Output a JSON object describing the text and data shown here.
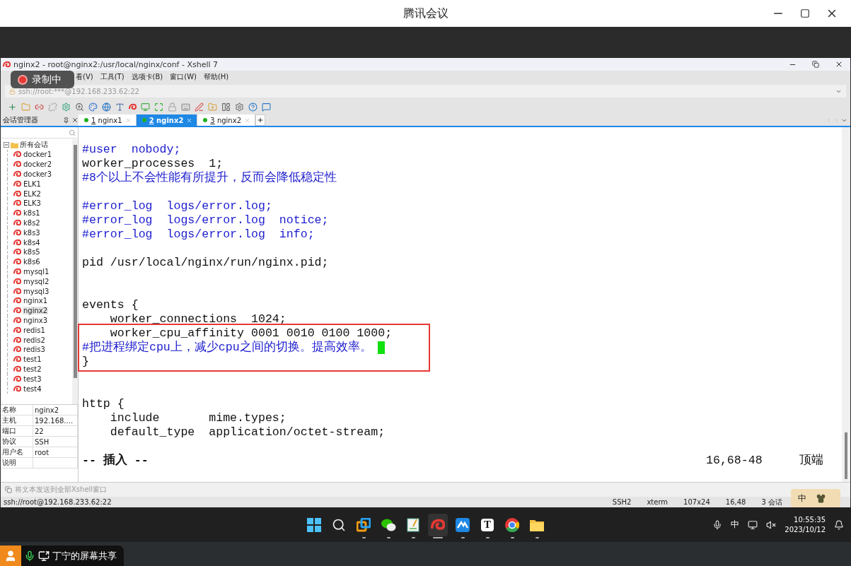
{
  "meeting_window": {
    "title": "腾讯会议"
  },
  "recording_badge": {
    "label": "录制中"
  },
  "xshell": {
    "title": "nginx2 - root@nginx2:/usr/local/nginx/conf - Xshell 7",
    "menu": [
      "看(V)",
      "工具(T)",
      "选项卡(B)",
      "窗口(W)",
      "帮助(H)"
    ],
    "address": "ssh://root:***@192.168.233.62:22",
    "session_panel": {
      "title": "会话管理器",
      "root": {
        "label": "所有会话",
        "expanded": true,
        "children": [
          {
            "label": "docker1",
            "selected": false
          },
          {
            "label": "docker2",
            "selected": false
          },
          {
            "label": "docker3",
            "selected": false
          },
          {
            "label": "ELK1",
            "selected": false
          },
          {
            "label": "ELK2",
            "selected": false
          },
          {
            "label": "ELK3",
            "selected": false
          },
          {
            "label": "k8s1",
            "selected": false
          },
          {
            "label": "k8s2",
            "selected": false
          },
          {
            "label": "k8s3",
            "selected": false
          },
          {
            "label": "k8s4",
            "selected": false
          },
          {
            "label": "k8s5",
            "selected": false
          },
          {
            "label": "k8s6",
            "selected": false
          },
          {
            "label": "mysql1",
            "selected": false
          },
          {
            "label": "mysql2",
            "selected": false
          },
          {
            "label": "mysql3",
            "selected": false
          },
          {
            "label": "nginx1",
            "selected": false
          },
          {
            "label": "nginx2",
            "selected": true
          },
          {
            "label": "nginx3",
            "selected": false
          },
          {
            "label": "redis1",
            "selected": false
          },
          {
            "label": "redis2",
            "selected": false
          },
          {
            "label": "redis3",
            "selected": false
          },
          {
            "label": "test1",
            "selected": false
          },
          {
            "label": "test2",
            "selected": false
          },
          {
            "label": "test3",
            "selected": false
          },
          {
            "label": "test4",
            "selected": false
          }
        ]
      }
    },
    "tabs": [
      {
        "number": "1",
        "label": "nginx1",
        "selected": false
      },
      {
        "number": "2",
        "label": "nginx2",
        "selected": true
      },
      {
        "number": "3",
        "label": "nginx2",
        "selected": false
      }
    ],
    "properties": [
      {
        "name": "名称",
        "value": "nginx2"
      },
      {
        "name": "主机",
        "value": "192.168...."
      },
      {
        "name": "端口",
        "value": "22"
      },
      {
        "name": "协议",
        "value": "SSH"
      },
      {
        "name": "用户名",
        "value": "root"
      },
      {
        "name": "说明"
      }
    ],
    "terminal": {
      "sections": [
        {
          "highlighted": false,
          "lines": [
            {
              "kind": "comment",
              "text": "#user  nobody;",
              "cursor": false
            },
            {
              "kind": "code",
              "text": "worker_processes  1;",
              "cursor": false
            },
            {
              "kind": "comment",
              "text": "#8个以上不会性能有所提升，反而会降低稳定性",
              "cursor": false
            },
            {
              "kind": "blank"
            },
            {
              "kind": "comment",
              "text": "#error_log  logs/error.log;",
              "cursor": false
            },
            {
              "kind": "comment",
              "text": "#error_log  logs/error.log  notice;",
              "cursor": false
            },
            {
              "kind": "comment",
              "text": "#error_log  logs/error.log  info;",
              "cursor": false
            },
            {
              "kind": "blank"
            },
            {
              "kind": "code",
              "text": "pid /usr/local/nginx/run/nginx.pid;",
              "cursor": false
            },
            {
              "kind": "blank"
            },
            {
              "kind": "blank"
            },
            {
              "kind": "code",
              "text": "events {",
              "cursor": false
            },
            {
              "kind": "code",
              "text": "    worker_connections  1024;",
              "cursor": false
            }
          ]
        },
        {
          "highlighted": true,
          "lines": [
            {
              "kind": "code",
              "text": "    worker_cpu_affinity 0001 0010 0100 1000;",
              "cursor": false
            },
            {
              "kind": "comment",
              "text": "#把进程绑定cpu上，减少cpu之间的切换。提高效率。",
              "cursor": true
            },
            {
              "kind": "code",
              "text": "}",
              "cursor": false
            }
          ]
        },
        {
          "highlighted": false,
          "lines": [
            {
              "kind": "blank"
            },
            {
              "kind": "blank"
            },
            {
              "kind": "code",
              "text": "http {",
              "cursor": false
            },
            {
              "kind": "code",
              "text": "    include       mime.types;",
              "cursor": false
            },
            {
              "kind": "code",
              "text": "    default_type  application/octet-stream;",
              "cursor": false
            },
            {
              "kind": "blank"
            }
          ]
        }
      ],
      "mode": "-- 插入 --",
      "position": "16,68-48",
      "scroll": "顶端"
    },
    "compose_bar": {
      "placeholder": "将文本发送到全部Xshell窗口"
    },
    "status_bar": {
      "address": "ssh://root@192.168.233.62:22",
      "protocol": "SSH2",
      "terminal_type": "xterm",
      "size": "107x24",
      "cursor": "16,48",
      "sessions": "3 会话"
    }
  },
  "ime_popup": {
    "label": "中"
  },
  "taskbar": {
    "apps": [
      {
        "kind": "windows",
        "active": false
      },
      {
        "kind": "search",
        "active": false
      },
      {
        "kind": "taskview",
        "active": false
      },
      {
        "kind": "wechat",
        "active": false
      },
      {
        "kind": "notepad",
        "active": false
      },
      {
        "kind": "xshell",
        "active": true
      },
      {
        "kind": "meeting",
        "active": false
      },
      {
        "kind": "typora",
        "active": false,
        "glyph": "T"
      },
      {
        "kind": "chrome",
        "active": false
      },
      {
        "kind": "files",
        "active": false
      }
    ],
    "language": "中",
    "time": "10:55:35",
    "date": "2023/10/12"
  },
  "screen_share": {
    "label": "丁宁的屏幕共享"
  }
}
